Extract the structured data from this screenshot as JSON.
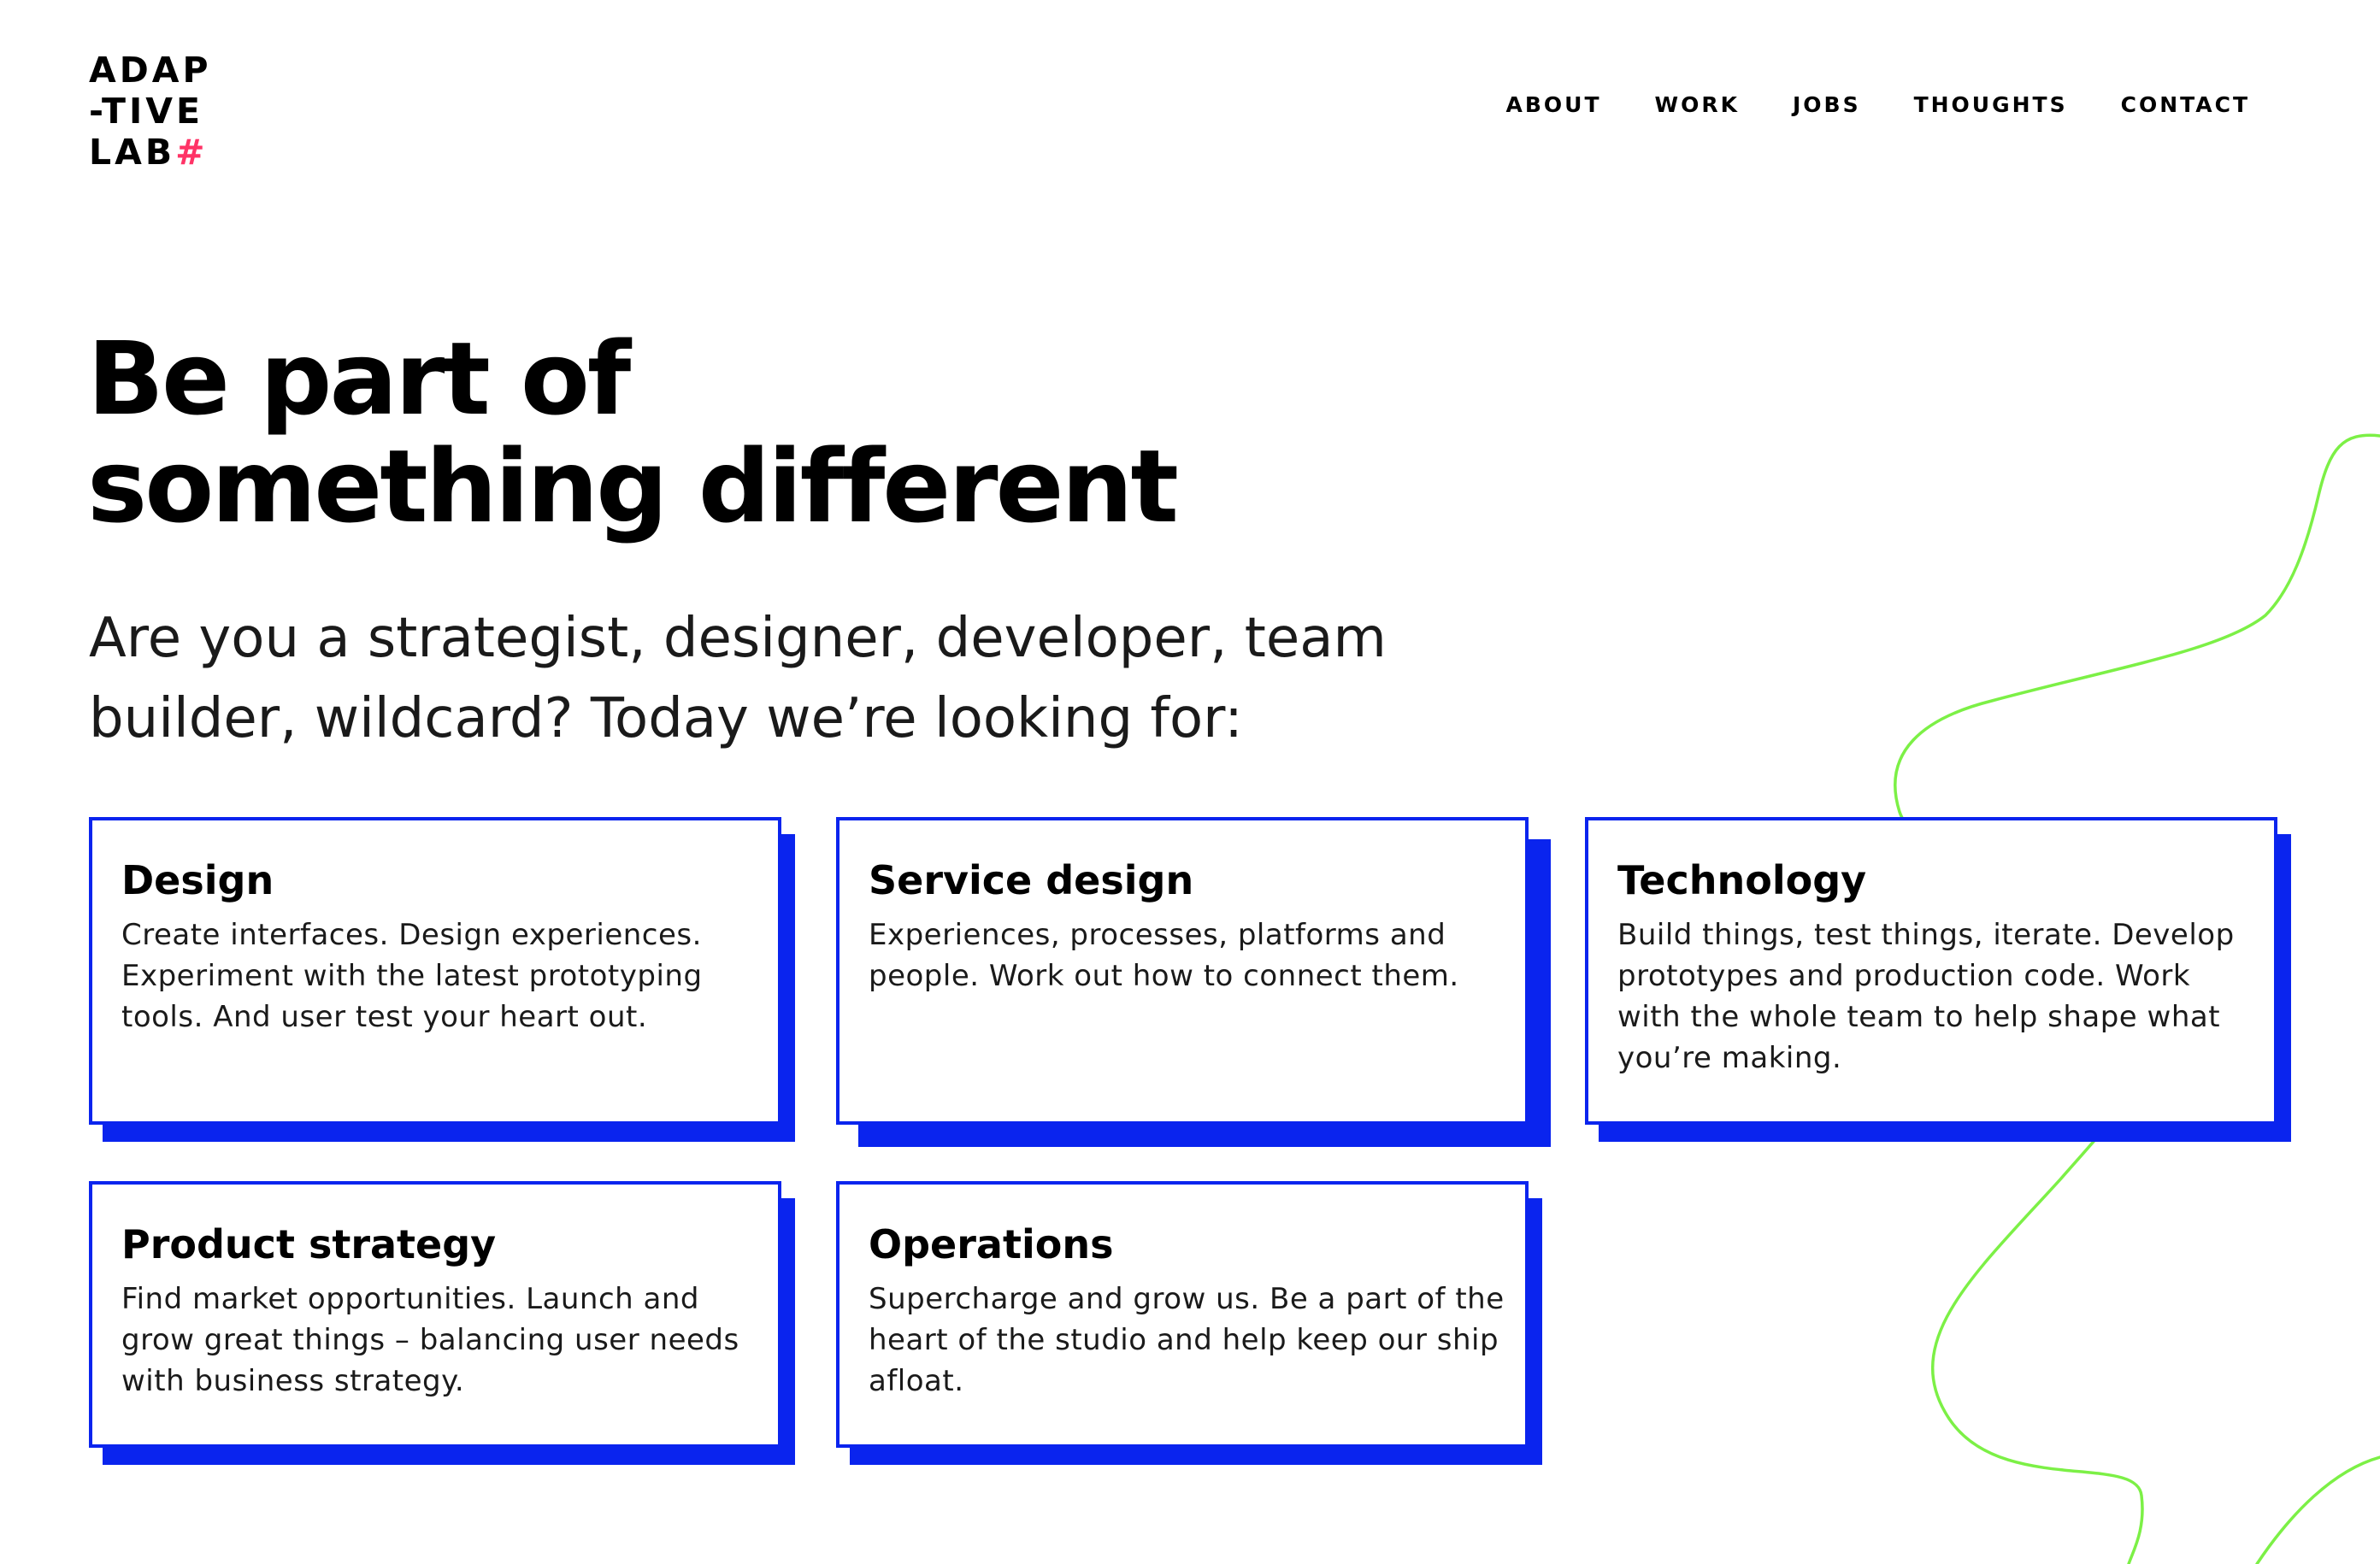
{
  "brand": {
    "logo_line1": "ADAP",
    "logo_line2": "-TIVE",
    "logo_line3": "LAB",
    "logo_hash": "#",
    "accent_color": "#ff3366"
  },
  "nav": {
    "items": [
      {
        "label": "ABOUT"
      },
      {
        "label": "WORK"
      },
      {
        "label": "JOBS"
      },
      {
        "label": "THOUGHTS"
      },
      {
        "label": "CONTACT"
      }
    ]
  },
  "hero": {
    "title_line1": "Be part of",
    "title_line2": "something different",
    "subtitle_line1": "Are you a strategist, designer, developer, team",
    "subtitle_line2": "builder, wildcard? Today we’re looking for:"
  },
  "roles": [
    {
      "title": "Design",
      "lines": [
        "Create interfaces. Design experiences.",
        "Experiment with the latest prototyping",
        "tools. And user test your heart out."
      ]
    },
    {
      "title": "Service design",
      "lines": [
        "Experiences, processes, platforms and",
        "people. Work out how to connect them."
      ]
    },
    {
      "title": "Technology",
      "lines": [
        "Build things, test things, iterate. Develop",
        "prototypes and production code. Work",
        "with the whole team to help shape what",
        "you’re making."
      ]
    },
    {
      "title": "Product strategy",
      "lines": [
        "Find market opportunities. Launch and",
        "grow great things – balancing user needs",
        "with business strategy."
      ]
    },
    {
      "title": "Operations",
      "lines": [
        "Supercharge and grow us. Be a part of the",
        "heart of the studio and help keep our ship",
        "afloat."
      ]
    }
  ],
  "colors": {
    "card_border": "#0a24ee",
    "squiggle": "#7cf046",
    "text": "#000000"
  }
}
